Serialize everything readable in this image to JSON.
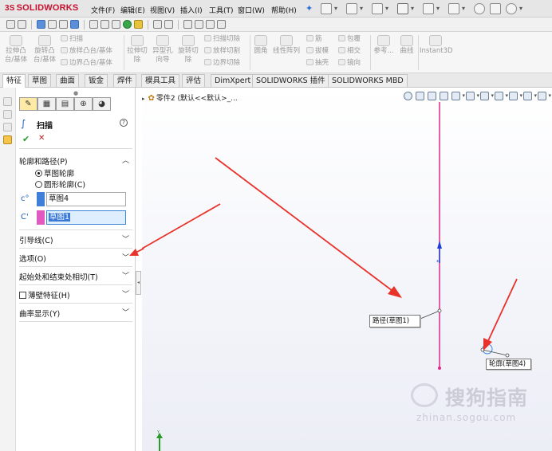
{
  "app": {
    "logo_prefix": "3S",
    "logo_text": "SOLIDWORKS"
  },
  "menu": [
    {
      "label": "文件(F)"
    },
    {
      "label": "编辑(E)"
    },
    {
      "label": "视图(V)"
    },
    {
      "label": "插入(I)"
    },
    {
      "label": "工具(T)"
    },
    {
      "label": "窗口(W)"
    },
    {
      "label": "帮助(H)"
    }
  ],
  "ribbon": {
    "big_buttons": [
      {
        "label_line1": "拉伸凸",
        "label_line2": "台/基体"
      },
      {
        "label_line1": "旋转凸",
        "label_line2": "台/基体"
      },
      {
        "label_line1": "拉伸切",
        "label_line2": "除"
      },
      {
        "label_line1": "异型孔",
        "label_line2": "向导"
      },
      {
        "label_line1": "旋转切",
        "label_line2": "除"
      },
      {
        "label_line1": "圆角",
        "label_line2": ""
      },
      {
        "label_line1": "线性阵列",
        "label_line2": ""
      },
      {
        "label_line1": "参考...",
        "label_line2": ""
      },
      {
        "label_line1": "曲线",
        "label_line2": ""
      },
      {
        "label_line1": "Instant3D",
        "label_line2": ""
      }
    ],
    "small_group1": [
      "扫描",
      "放样凸台/基体",
      "边界凸台/基体"
    ],
    "small_group2": [
      "扫描切除",
      "放样切割",
      "边界切除"
    ],
    "small_group3": [
      "筋",
      "拔模",
      "抽壳"
    ],
    "small_group4": [
      "包覆",
      "相交",
      "镜向"
    ]
  },
  "tabs": [
    {
      "label": "特征",
      "active": true
    },
    {
      "label": "草图",
      "active": false
    },
    {
      "label": "曲面",
      "active": false
    },
    {
      "label": "钣金",
      "active": false
    },
    {
      "label": "焊件",
      "active": false
    },
    {
      "label": "模具工具",
      "active": false
    },
    {
      "label": "评估",
      "active": false
    },
    {
      "label": "DimXpert",
      "active": false
    },
    {
      "label": "SOLIDWORKS 插件",
      "active": false
    },
    {
      "label": "SOLIDWORKS MBD",
      "active": false
    }
  ],
  "property_manager": {
    "title": "扫描",
    "help_glyph": "?",
    "ok_glyph": "✔",
    "cancel_glyph": "✕",
    "groups": {
      "profile_path": {
        "label": "轮廓和路径(P)",
        "chevron": "︿"
      },
      "guide_curves": {
        "label": "引导线(C)",
        "chevron": "﹀"
      },
      "options": {
        "label": "选项(O)",
        "chevron": "﹀"
      },
      "tangency": {
        "label": "起始处和结束处相切(T)",
        "chevron": "﹀"
      },
      "thin_feature": {
        "label": "薄壁特征(H)",
        "chevron": "﹀"
      },
      "curvature": {
        "label": "曲率显示(Y)",
        "chevron": "﹀"
      }
    },
    "radio_sketch_profile": "草图轮廓",
    "radio_circle_profile": "圆形轮廓(C)",
    "profile_selection": "草图4",
    "path_selection": "草图1",
    "profile_swatch_color": "#3f7fd9",
    "path_swatch_color": "#e05ac0"
  },
  "viewport": {
    "breadcrumb": "零件2 (默认<<默认>_...",
    "callout_path": "路径(草图1)",
    "callout_profile": "轮廓(草图4)",
    "watermark_cn": "搜狗指南",
    "watermark_url": "zhinan.sogou.com",
    "path_color": "#e0288a",
    "arrow_color": "#e8322a"
  }
}
